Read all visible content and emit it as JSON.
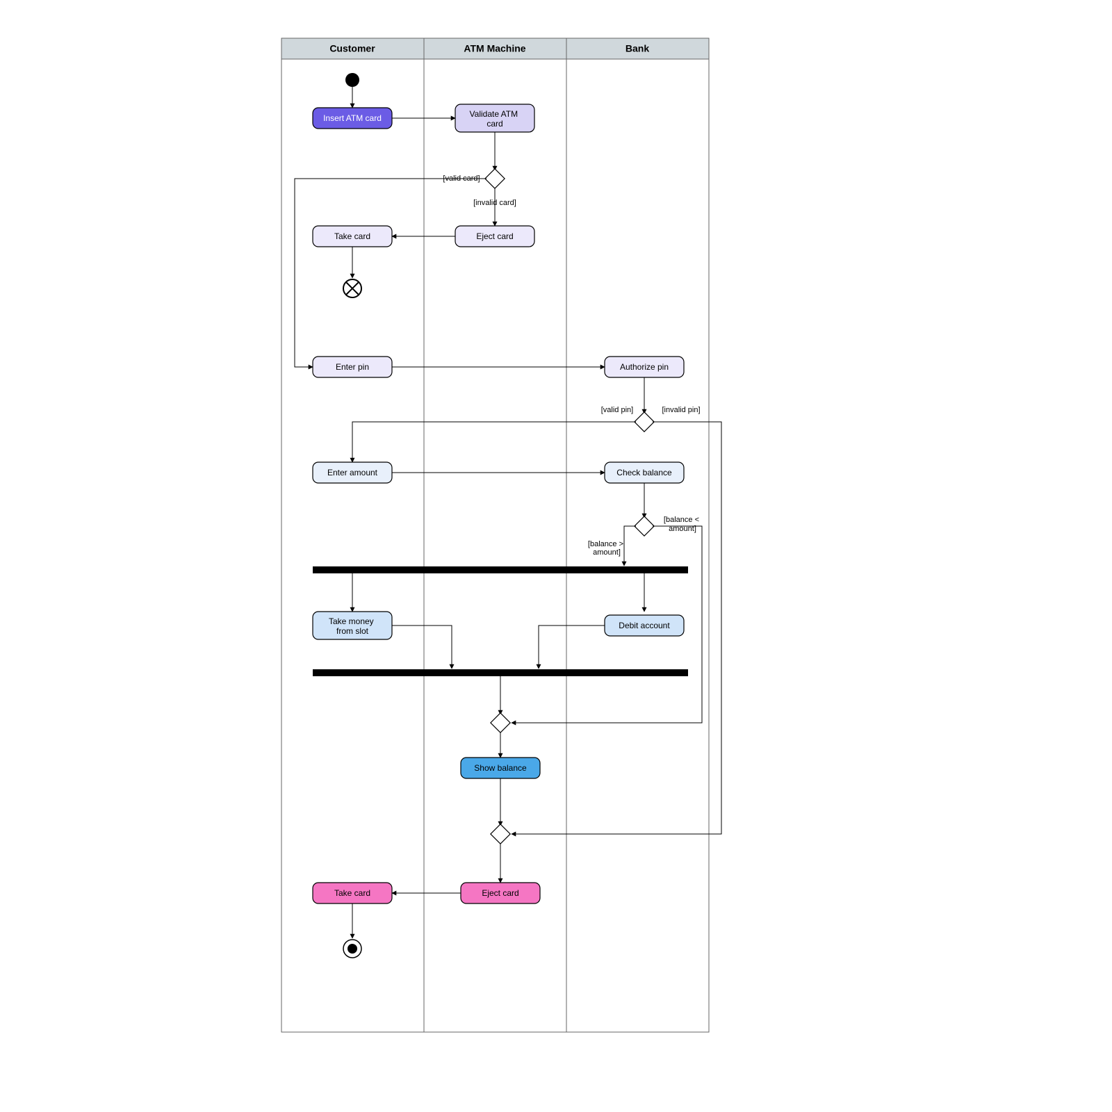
{
  "lanes": {
    "customer": "Customer",
    "atm": "ATM Machine",
    "bank": "Bank"
  },
  "nodes": {
    "insert_card": "Insert ATM card",
    "validate_card": "Validate ATM\ncard",
    "eject_card_1": "Eject card",
    "take_card_1": "Take card",
    "enter_pin": "Enter pin",
    "authorize_pin": "Authorize pin",
    "enter_amount": "Enter amount",
    "check_balance": "Check balance",
    "take_money": "Take money\nfrom slot",
    "debit_account": "Debit account",
    "show_balance": "Show balance",
    "eject_card_2": "Eject card",
    "take_card_2": "Take card"
  },
  "guards": {
    "valid_card": "[valid card]",
    "invalid_card": "[invalid card]",
    "valid_pin": "[valid pin]",
    "invalid_pin": "[invalid pin]",
    "balance_gt": "[balance >\namount]",
    "balance_lt": "[balance <\namount]"
  },
  "colors": {
    "purple_dark": "#6b5ce5",
    "purple_light": "#d8d3f5",
    "lavender": "#ece9fb",
    "pale_blue": "#e8f0fb",
    "light_blue": "#d0e4f9",
    "blue": "#4aa8e8",
    "pink": "#f576c3"
  }
}
